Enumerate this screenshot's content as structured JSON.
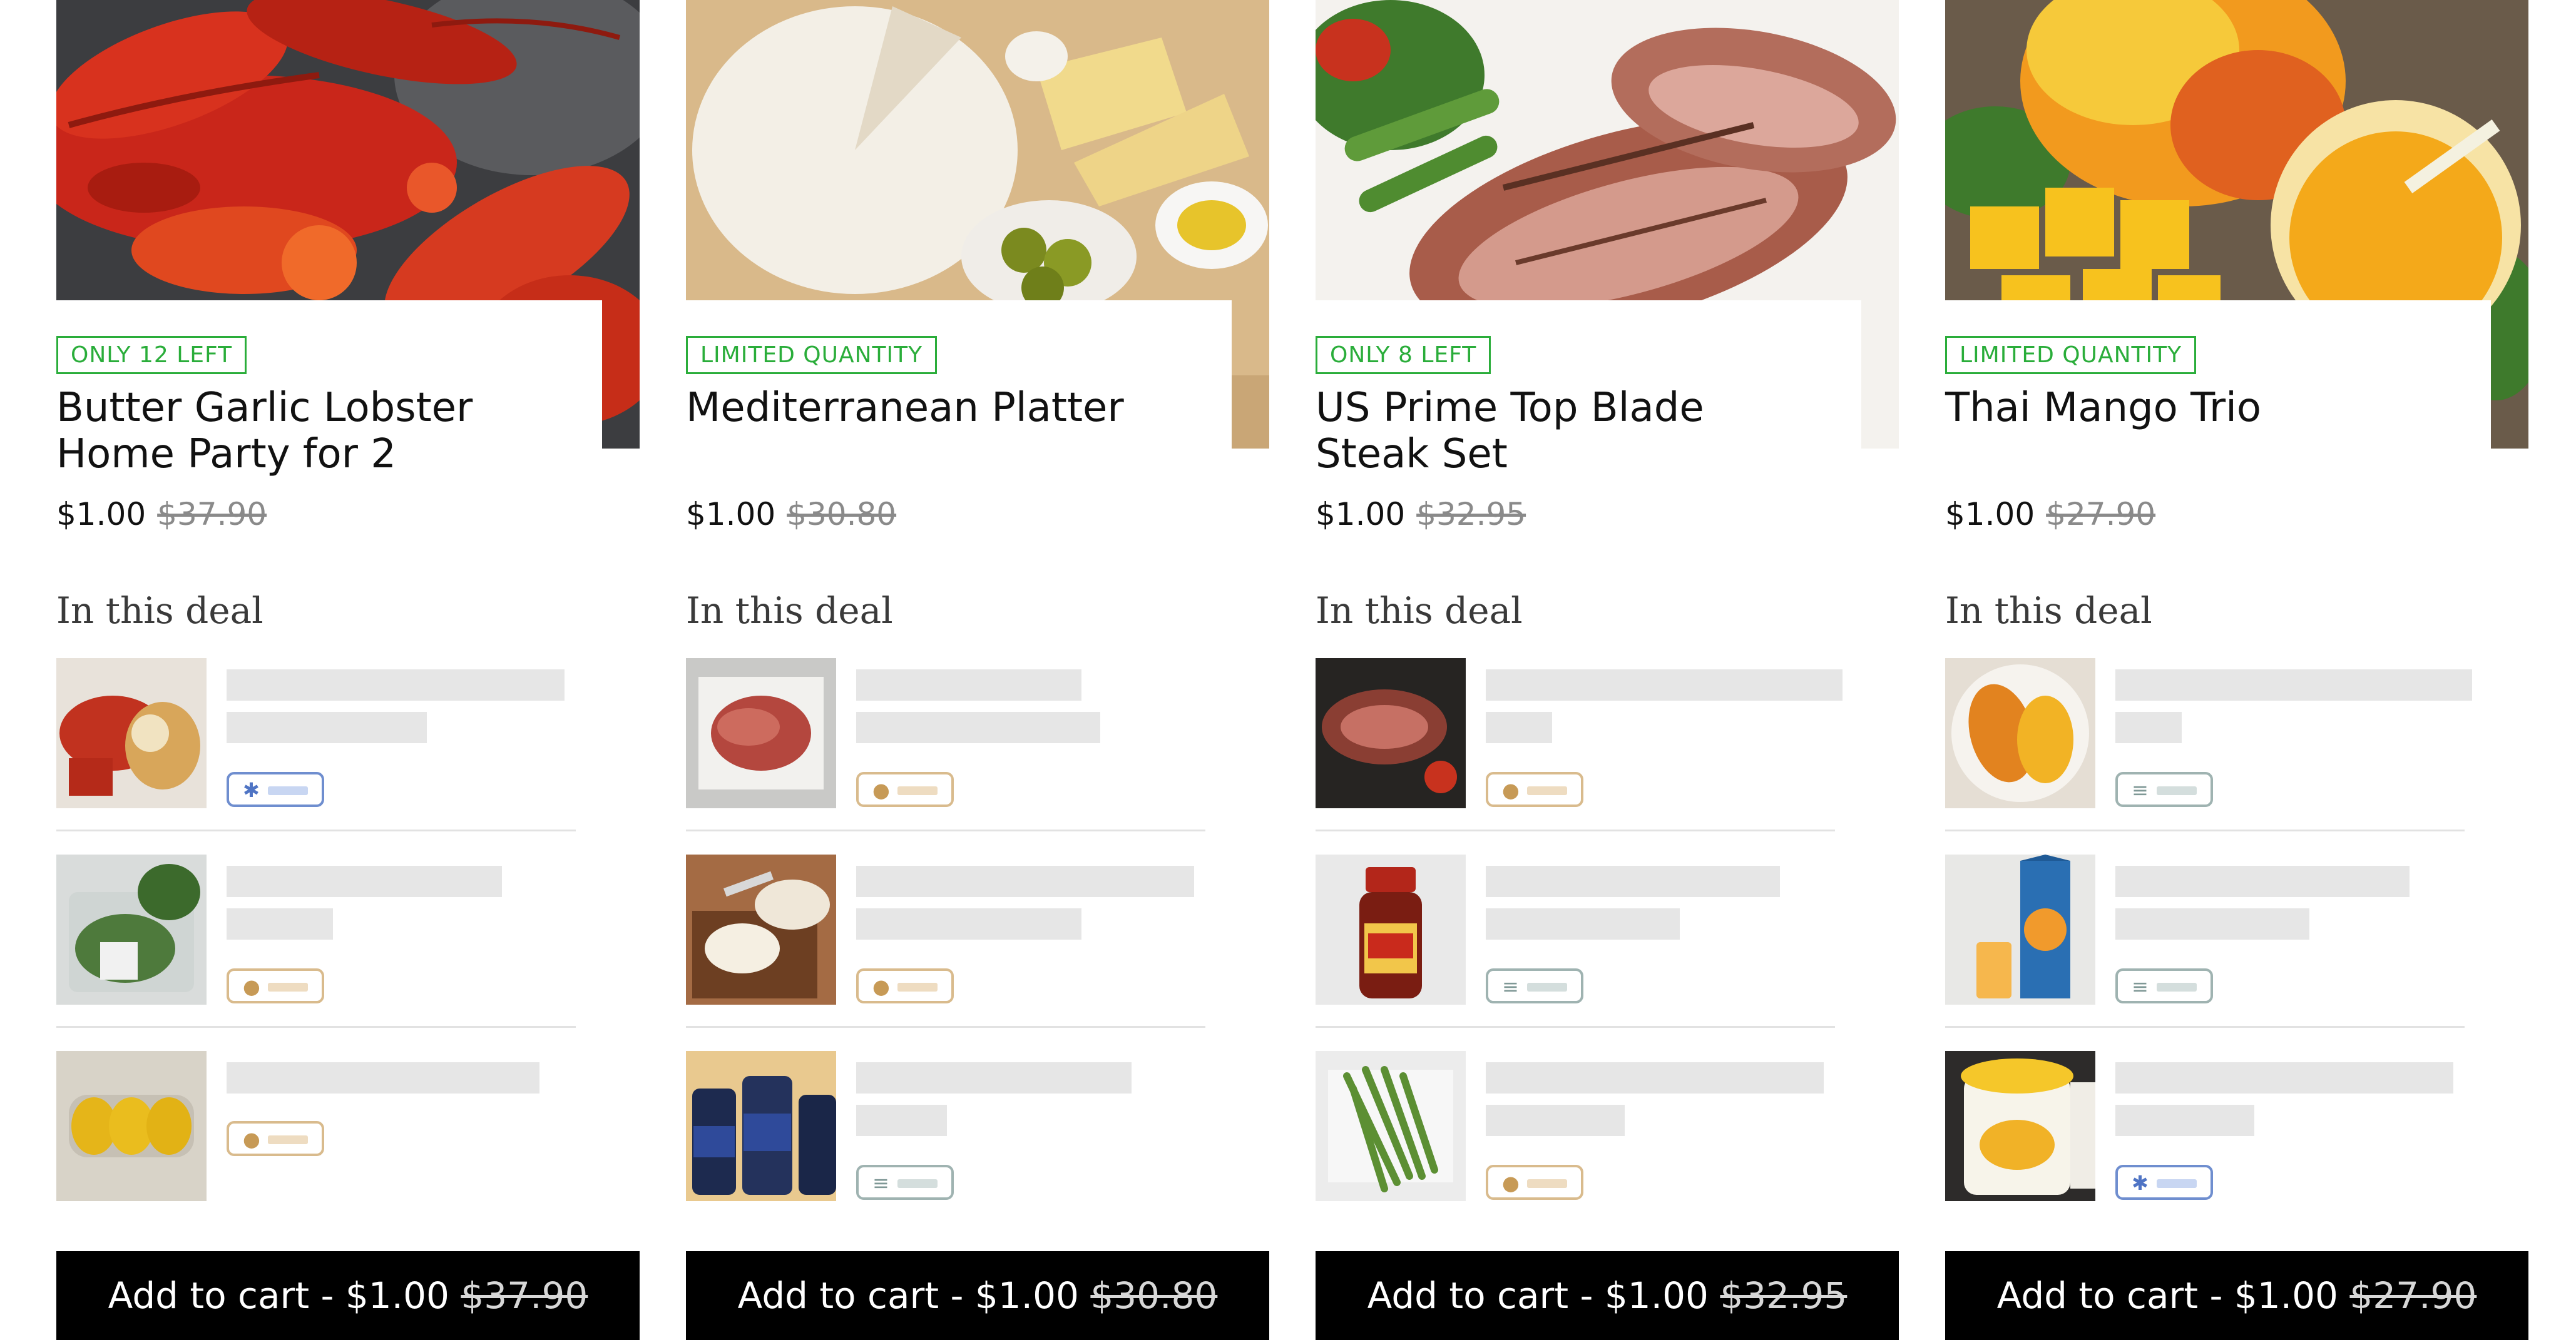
{
  "colors": {
    "badge_green": "#2aad3a",
    "cta_background": "#000000",
    "skeleton": "#e6e6e6",
    "chip_drop": "#d9bb8d",
    "chip_frozen": "#6f8ecf",
    "chip_pantry": "#9fb3b1"
  },
  "deal_heading": "In this deal",
  "cards": [
    {
      "badge": "ONLY 12 LEFT",
      "title_line1": "Butter Garlic Lobster",
      "title_line2": "Home Party for 2",
      "price_now": "$1.00",
      "price_was": "$37.90",
      "cta_label": "Add to cart - $1.00",
      "cta_was": "$37.90",
      "items": [
        {
          "thumb": "lobster-platter",
          "chip": "frozen",
          "chip_icon": "snowflake-icon"
        },
        {
          "thumb": "leafy-greens",
          "chip": "drop",
          "chip_icon": "droplet-icon"
        },
        {
          "thumb": "lemons-pack",
          "chip": "drop",
          "chip_icon": "droplet-icon"
        }
      ]
    },
    {
      "badge": "LIMITED QUANTITY",
      "title_line1": "Mediterranean Platter",
      "title_line2": "",
      "price_now": "$1.00",
      "price_was": "$30.80",
      "cta_label": "Add to cart - $1.00",
      "cta_was": "$30.80",
      "items": [
        {
          "thumb": "prosciutto",
          "chip": "drop",
          "chip_icon": "droplet-icon"
        },
        {
          "thumb": "soft-cheese",
          "chip": "drop",
          "chip_icon": "droplet-icon"
        },
        {
          "thumb": "olive-jars",
          "chip": "pantry",
          "chip_icon": "pantry-icon"
        }
      ]
    },
    {
      "badge": "ONLY 8 LEFT",
      "title_line1": "US Prime Top Blade",
      "title_line2": "Steak Set",
      "price_now": "$1.00",
      "price_was": "$32.95",
      "cta_label": "Add to cart - $1.00",
      "cta_was": "$32.95",
      "items": [
        {
          "thumb": "sliced-steak",
          "chip": "drop",
          "chip_icon": "droplet-icon"
        },
        {
          "thumb": "bbq-sauce-bottle",
          "chip": "pantry",
          "chip_icon": "pantry-icon"
        },
        {
          "thumb": "asparagus",
          "chip": "drop",
          "chip_icon": "droplet-icon"
        }
      ]
    },
    {
      "badge": "LIMITED QUANTITY",
      "title_line1": "Thai Mango Trio",
      "title_line2": "",
      "price_now": "$1.00",
      "price_was": "$27.90",
      "cta_label": "Add to cart - $1.00",
      "cta_was": "$27.90",
      "items": [
        {
          "thumb": "sliced-mango",
          "chip": "pantry",
          "chip_icon": "pantry-icon"
        },
        {
          "thumb": "juice-carton",
          "chip": "pantry",
          "chip_icon": "pantry-icon"
        },
        {
          "thumb": "mango-ice-cream",
          "chip": "frozen",
          "chip_icon": "snowflake-icon"
        }
      ]
    }
  ]
}
